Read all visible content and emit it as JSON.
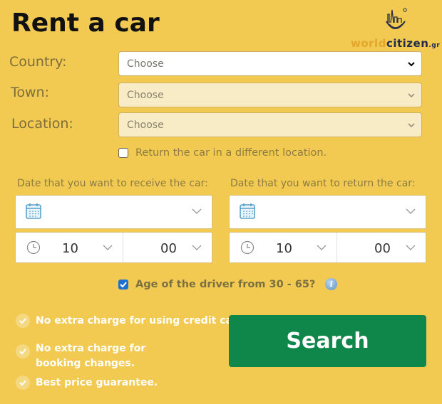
{
  "header": {
    "title": "Rent a car",
    "logo": {
      "part1": "world",
      "part2": "citizen",
      "suffix": ".gr",
      "icon": "city-smile-logo-icon"
    }
  },
  "form": {
    "country": {
      "label": "Country:",
      "value": "Choose",
      "icon": "chevron-down-icon"
    },
    "town": {
      "label": "Town:",
      "value": "Choose",
      "icon": "chevron-down-icon"
    },
    "location": {
      "label": "Location:",
      "value": "Choose",
      "icon": "chevron-down-icon"
    },
    "return_different": {
      "label": "Return the car in a different location.",
      "checked": false
    },
    "pickup": {
      "label": "Date that you want to receive the car:",
      "date": "",
      "hour": "10",
      "minute": "00",
      "icons": [
        "calendar-icon",
        "clock-icon",
        "chevron-down-icon"
      ]
    },
    "dropoff": {
      "label": "Date that you want to return the car:",
      "date": "",
      "hour": "10",
      "minute": "00",
      "icons": [
        "calendar-icon",
        "clock-icon",
        "chevron-down-icon"
      ]
    },
    "driver_age": {
      "label": "Age of the driver from 30 - 65?",
      "checked": true,
      "info_icon": "info-icon",
      "info_glyph": "i"
    },
    "search_label": "Search"
  },
  "perks": [
    "No extra charge for using credit card.",
    "No extra charge for booking changes.",
    "Best price guarantee."
  ],
  "colors": {
    "background": "#f2ca52",
    "search_button": "#0f864a",
    "checkbox_checked": "#1f6fd0"
  }
}
